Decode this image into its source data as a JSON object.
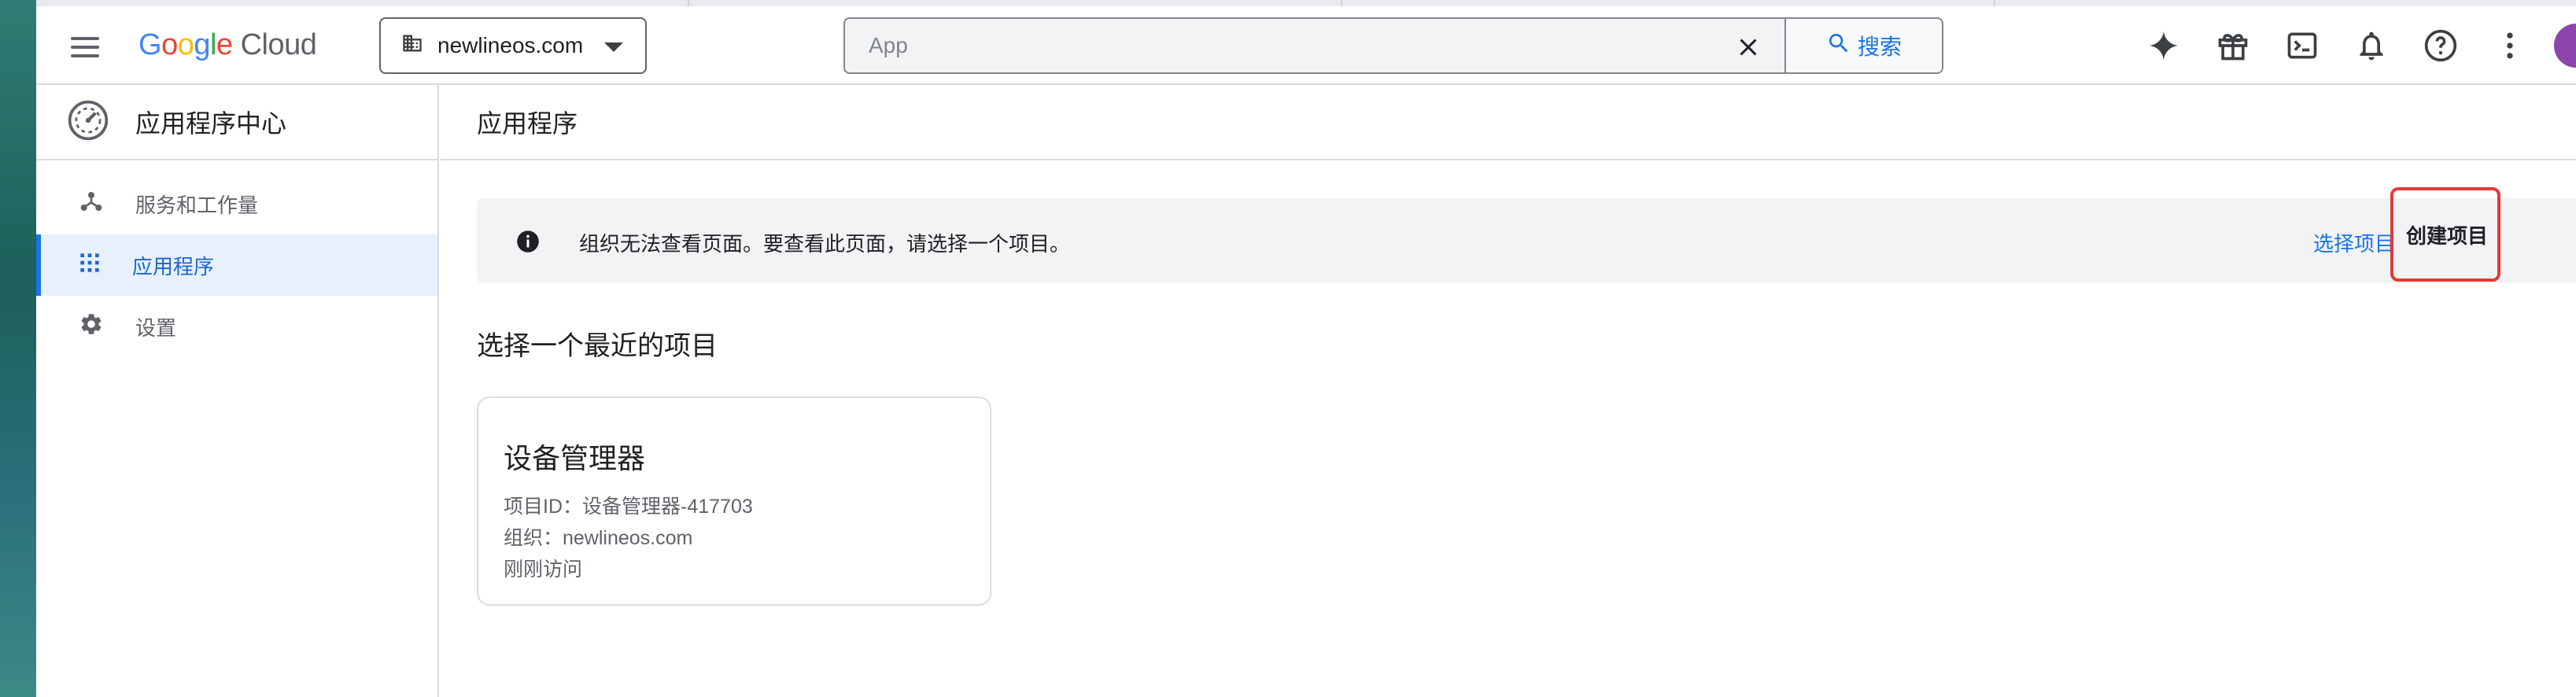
{
  "topbar": {
    "logo_google": "Google",
    "logo_cloud": "Cloud",
    "org_name": "newlineos.com",
    "search_placeholder": "App",
    "search_button_label": "搜索"
  },
  "sidebar": {
    "title": "应用程序中心",
    "items": [
      {
        "label": "服务和工作量",
        "icon": "hub-icon",
        "active": false
      },
      {
        "label": "应用程序",
        "icon": "apps-grid-icon",
        "active": true
      },
      {
        "label": "设置",
        "icon": "gear-icon",
        "active": false
      }
    ]
  },
  "main": {
    "title": "应用程序",
    "banner": {
      "message": "组织无法查看页面。要查看此页面，请选择一个项目。",
      "select_project_label": "选择项目",
      "create_project_label": "创建项目"
    },
    "recent_title": "选择一个最近的项目",
    "project_card": {
      "name": "设备管理器",
      "project_id_line": "项目ID：设备管理器-417703",
      "org_line": "组织：newlineos.com",
      "visited_line": "刚刚访问"
    }
  },
  "colors": {
    "accent": "#1a73e8",
    "active_bg": "#e8f0fe",
    "highlight_border": "#e53935",
    "banner_bg": "#f1f3f4"
  }
}
